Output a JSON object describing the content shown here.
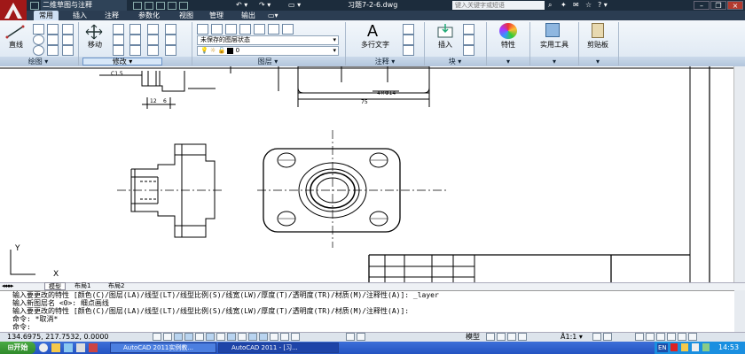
{
  "title_bar": {
    "workspace": "二维草图与注释",
    "filename": "习题7-2-6.dwg",
    "search_placeholder": "键入关键字或短语"
  },
  "tabs": [
    "常用",
    "插入",
    "注释",
    "参数化",
    "视图",
    "管理",
    "输出"
  ],
  "active_tab": "常用",
  "ribbon": {
    "draw": {
      "line_label": "直线",
      "panel_label": "绘图"
    },
    "modify": {
      "move_label": "移动",
      "panel_label": "修改"
    },
    "layers": {
      "state_label": "未保存的图层状态",
      "current_layer": "0",
      "panel_label": "图层"
    },
    "annotation": {
      "text_label": "多行文字",
      "panel_label": "注释"
    },
    "block": {
      "insert_label": "插入",
      "panel_label": "块"
    },
    "properties_label": "特性",
    "utilities_label": "实用工具",
    "clipboard_label": "剪贴板"
  },
  "drawing": {
    "dims": [
      "C1.5",
      "12",
      "6",
      "4×Φ14",
      "75"
    ],
    "ucs_x": "X",
    "ucs_y": "Y"
  },
  "layout_tabs": [
    "模型",
    "布局1",
    "布局2"
  ],
  "command_lines": [
    "输入要更改的特性 [颜色(C)/图层(LA)/线型(LT)/线型比例(S)/线宽(LW)/厚度(T)/透明度(TR)/材质(M)/注释性(A)]: _layer",
    "输入新图层名 <0>: 细点画线",
    "输入要更改的特性 [颜色(C)/图层(LA)/线型(LT)/线型比例(S)/线宽(LW)/厚度(T)/透明度(TR)/材质(M)/注释性(A)]:",
    "命令: *取消*",
    "命令:"
  ],
  "status_bar": {
    "coords": "134.6975, 217.7532, 0.0000",
    "model_label": "模型",
    "scale": "1:1"
  },
  "taskbar": {
    "start_label": "开始",
    "tasks": [
      "AutoCAD 2011实例教...",
      "AutoCAD 2011 - [习..."
    ],
    "clock": "14:53",
    "lang": "EN"
  },
  "colors": {
    "app_red": "#a01818",
    "titlebar": "#1c2c3c",
    "taskbar": "#2353c2"
  }
}
